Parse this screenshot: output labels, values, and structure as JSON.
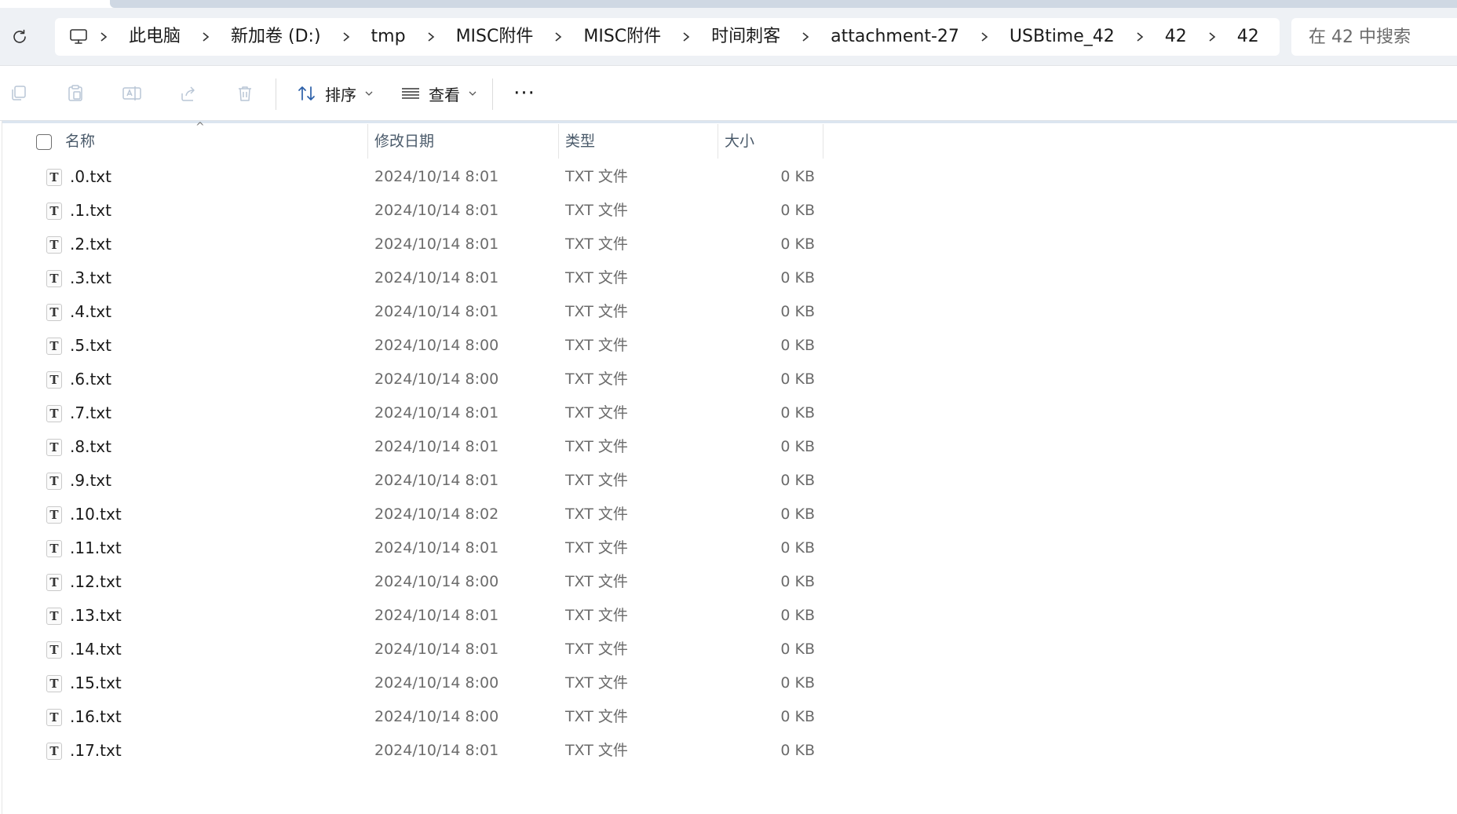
{
  "address_bar": {
    "breadcrumbs": [
      "此电脑",
      "新加卷 (D:)",
      "tmp",
      "MISC附件",
      "MISC附件",
      "时间刺客",
      "attachment-27",
      "USBtime_42",
      "42",
      "42"
    ],
    "search_placeholder": "在 42 中搜索"
  },
  "command_bar": {
    "sort_label": "排序",
    "view_label": "查看",
    "more_label": "···"
  },
  "file_list": {
    "columns": {
      "name": "名称",
      "modified": "修改日期",
      "type": "类型",
      "size": "大小"
    },
    "rows": [
      {
        "icon": "T",
        "name": ".0.txt",
        "modified": "2024/10/14 8:01",
        "type": "TXT 文件",
        "size": "0 KB"
      },
      {
        "icon": "T",
        "name": ".1.txt",
        "modified": "2024/10/14 8:01",
        "type": "TXT 文件",
        "size": "0 KB"
      },
      {
        "icon": "T",
        "name": ".2.txt",
        "modified": "2024/10/14 8:01",
        "type": "TXT 文件",
        "size": "0 KB"
      },
      {
        "icon": "T",
        "name": ".3.txt",
        "modified": "2024/10/14 8:01",
        "type": "TXT 文件",
        "size": "0 KB"
      },
      {
        "icon": "T",
        "name": ".4.txt",
        "modified": "2024/10/14 8:01",
        "type": "TXT 文件",
        "size": "0 KB"
      },
      {
        "icon": "T",
        "name": ".5.txt",
        "modified": "2024/10/14 8:00",
        "type": "TXT 文件",
        "size": "0 KB"
      },
      {
        "icon": "T",
        "name": ".6.txt",
        "modified": "2024/10/14 8:00",
        "type": "TXT 文件",
        "size": "0 KB"
      },
      {
        "icon": "T",
        "name": ".7.txt",
        "modified": "2024/10/14 8:01",
        "type": "TXT 文件",
        "size": "0 KB"
      },
      {
        "icon": "T",
        "name": ".8.txt",
        "modified": "2024/10/14 8:01",
        "type": "TXT 文件",
        "size": "0 KB"
      },
      {
        "icon": "T",
        "name": ".9.txt",
        "modified": "2024/10/14 8:01",
        "type": "TXT 文件",
        "size": "0 KB"
      },
      {
        "icon": "T",
        "name": ".10.txt",
        "modified": "2024/10/14 8:02",
        "type": "TXT 文件",
        "size": "0 KB"
      },
      {
        "icon": "T",
        "name": ".11.txt",
        "modified": "2024/10/14 8:01",
        "type": "TXT 文件",
        "size": "0 KB"
      },
      {
        "icon": "T",
        "name": ".12.txt",
        "modified": "2024/10/14 8:00",
        "type": "TXT 文件",
        "size": "0 KB"
      },
      {
        "icon": "T",
        "name": ".13.txt",
        "modified": "2024/10/14 8:01",
        "type": "TXT 文件",
        "size": "0 KB"
      },
      {
        "icon": "T",
        "name": ".14.txt",
        "modified": "2024/10/14 8:01",
        "type": "TXT 文件",
        "size": "0 KB"
      },
      {
        "icon": "T",
        "name": ".15.txt",
        "modified": "2024/10/14 8:00",
        "type": "TXT 文件",
        "size": "0 KB"
      },
      {
        "icon": "T",
        "name": ".16.txt",
        "modified": "2024/10/14 8:00",
        "type": "TXT 文件",
        "size": "0 KB"
      },
      {
        "icon": "T",
        "name": ".17.txt",
        "modified": "2024/10/14 8:01",
        "type": "TXT 文件",
        "size": "0 KB"
      }
    ]
  }
}
